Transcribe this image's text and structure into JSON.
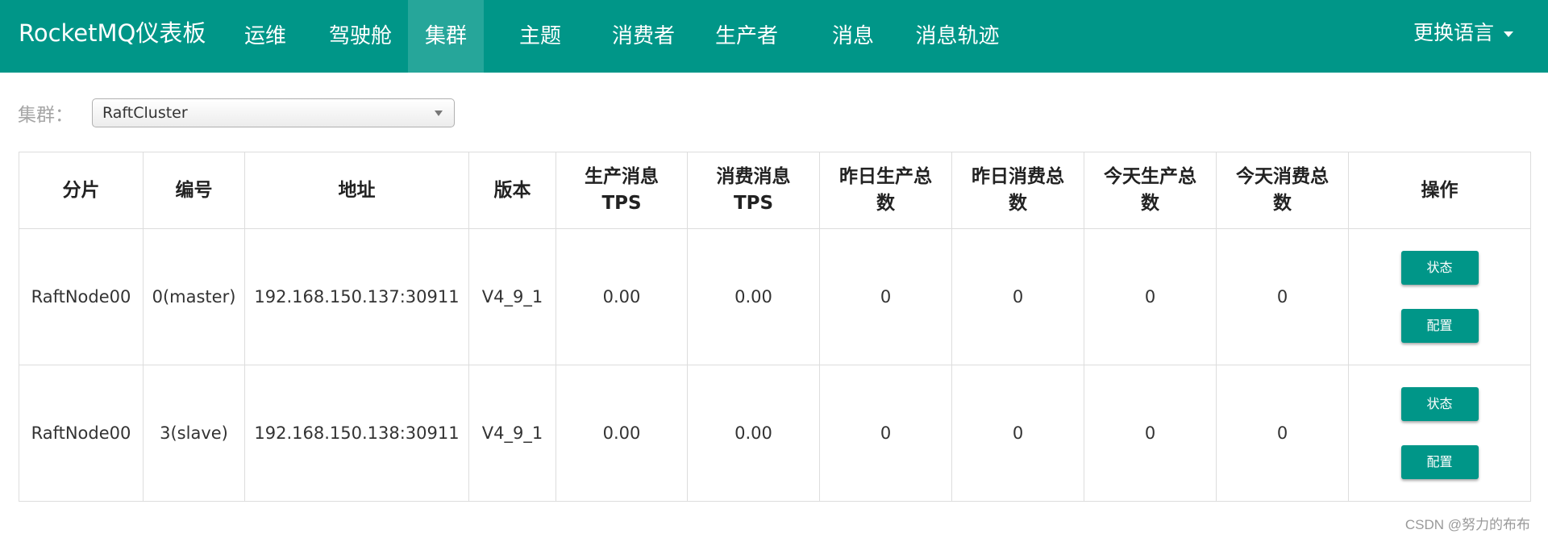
{
  "app": {
    "title": "RocketMQ仪表板"
  },
  "nav": {
    "items": [
      {
        "label": "运维"
      },
      {
        "label": "驾驶舱"
      },
      {
        "label": "集群"
      },
      {
        "label": "主题"
      },
      {
        "label": "消费者"
      },
      {
        "label": "生产者"
      },
      {
        "label": "消息"
      },
      {
        "label": "消息轨迹"
      }
    ],
    "active_index": 2,
    "language_label": "更换语言"
  },
  "cluster": {
    "label": "集群：",
    "selected": "RaftCluster"
  },
  "table": {
    "headers": [
      "分片",
      "编号",
      "地址",
      "版本",
      "生产消息TPS",
      "消费消息TPS",
      "昨日生产总数",
      "昨日消费总数",
      "今天生产总数",
      "今天消费总数",
      "操作"
    ],
    "rows": [
      {
        "shard": "RaftNode00",
        "id": "0(master)",
        "address": "192.168.150.137:30911",
        "version": "V4_9_1",
        "produce_tps": "0.00",
        "consume_tps": "0.00",
        "yesterday_produce": "0",
        "yesterday_consume": "0",
        "today_produce": "0",
        "today_consume": "0"
      },
      {
        "shard": "RaftNode00",
        "id": "3(slave)",
        "address": "192.168.150.138:30911",
        "version": "V4_9_1",
        "produce_tps": "0.00",
        "consume_tps": "0.00",
        "yesterday_produce": "0",
        "yesterday_consume": "0",
        "today_produce": "0",
        "today_consume": "0"
      }
    ],
    "actions": {
      "status_label": "状态",
      "config_label": "配置"
    }
  },
  "watermark": "CSDN @努力的布布",
  "colors": {
    "primary": "#009688",
    "active_nav": "#26a69a"
  }
}
